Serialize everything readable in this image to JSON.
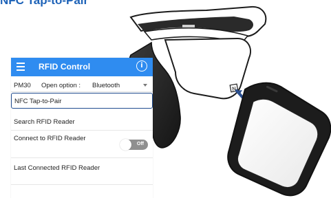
{
  "header": {
    "title": "NFC Tap-to-Pair"
  },
  "app": {
    "title": "RFID Control",
    "device_model": "PM30",
    "open_option_label": "Open option :",
    "open_option_value": "Bluetooth",
    "nfc_label": "NFC Tap-to-Pair",
    "search_label": "Search RFID Reader",
    "connect_label": "Connect to RFID Reader",
    "toggle_state": "Off",
    "last_connected_label": "Last Connected RFID Reader"
  },
  "colors": {
    "appbar": "#2f8cf0",
    "title_blue": "#1e63b8",
    "highlight_border": "#1f4b8f"
  },
  "icons": {
    "menu": "hamburger-icon",
    "info": "info-icon",
    "nfc": "nfc-icon"
  }
}
